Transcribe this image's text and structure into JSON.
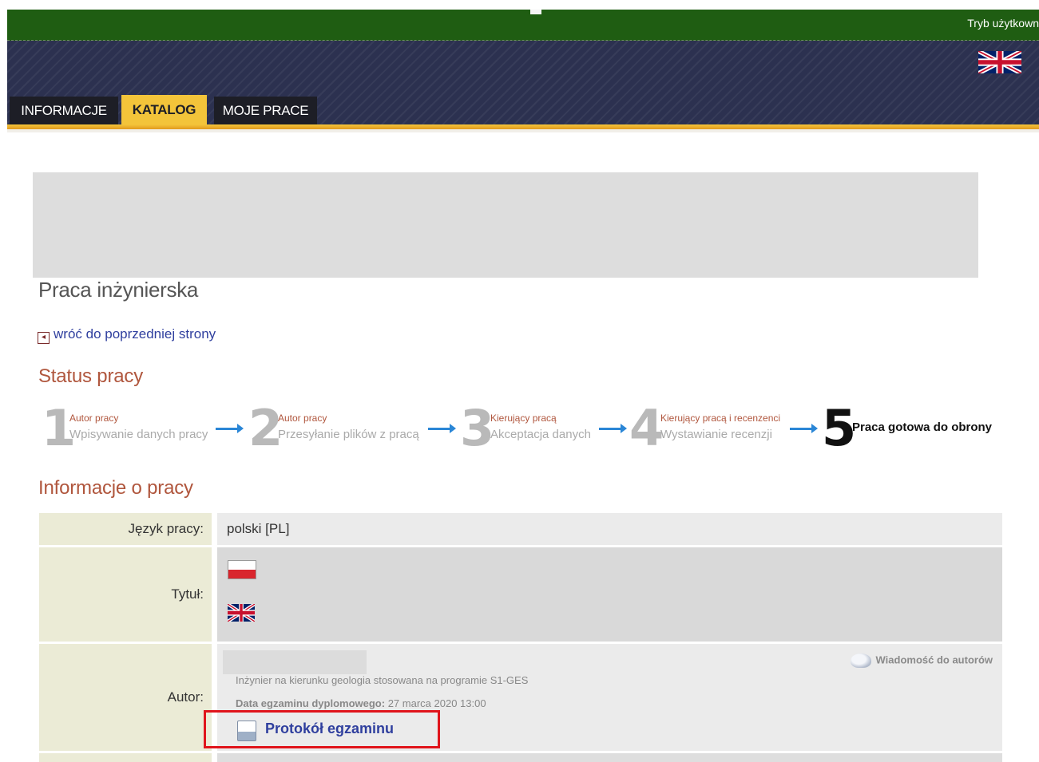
{
  "topbar": {
    "mode_text": "Tryb użytkown"
  },
  "header": {
    "language_flag": "uk-flag-icon"
  },
  "tabs": [
    {
      "label": "INFORMACJE",
      "active": false
    },
    {
      "label": "KATALOG",
      "active": true
    },
    {
      "label": "MOJE PRACE",
      "active": false
    }
  ],
  "page": {
    "title": "Praca inżynierska",
    "back_link": "wróć do poprzedniej strony",
    "status_heading": "Status pracy",
    "info_heading": "Informacje o pracy"
  },
  "steps": [
    {
      "num": "1",
      "who": "Autor pracy",
      "what": "Wpisywanie danych pracy"
    },
    {
      "num": "2",
      "who": "Autor pracy",
      "what": "Przesyłanie plików z pracą"
    },
    {
      "num": "3",
      "who": "Kierujący pracą",
      "what": "Akceptacja danych"
    },
    {
      "num": "4",
      "who": "Kierujący pracą i recenzenci",
      "what": "Wystawianie recenzji"
    },
    {
      "num": "5",
      "label": "Praca gotowa do obrony"
    }
  ],
  "info": {
    "language_label": "Język pracy:",
    "language_value": "polski [PL]",
    "title_label": "Tytuł:",
    "author_label": "Autor:",
    "message_link": "Wiadomość do autorów",
    "degree_text": "Inżynier na kierunku geologia stosowana na programie S1-GES",
    "exam_date_label": "Data egzaminu dyplomowego:",
    "exam_date_value": "27 marca 2020 13:00",
    "protocol_link": "Protokół egzaminu"
  },
  "colors": {
    "topbar": "#1f5d12",
    "header": "#2c3150",
    "tab_active": "#f3c43a",
    "heading": "#b0563d",
    "link": "#2f3f9e",
    "highlight": "#e0141b",
    "arrow": "#2a86d6"
  }
}
